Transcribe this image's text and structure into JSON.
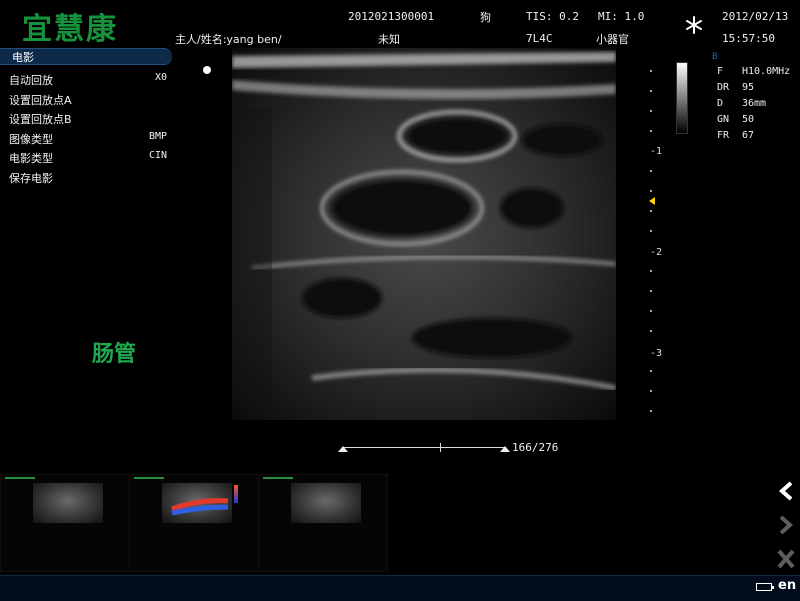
{
  "header": {
    "brand": "宜慧康",
    "patient_id": "2012021300001",
    "species": "狗",
    "tis": "TIS: 0.2",
    "mi": "MI: 1.0",
    "date": "2012/02/13",
    "owner_name": "主人/姓名:yang ben/",
    "gender": "未知",
    "probe": "7L4C",
    "exam_preset": "小器官",
    "time": "15:57:50",
    "freeze_icon": "snowflake-icon"
  },
  "menu": {
    "title": "电影",
    "items": [
      {
        "label": "自动回放",
        "value": "X0"
      },
      {
        "label": "设置回放点A",
        "value": ""
      },
      {
        "label": "设置回放点B",
        "value": ""
      },
      {
        "label": "图像类型",
        "value": "BMP"
      },
      {
        "label": "电影类型",
        "value": "CIN"
      },
      {
        "label": "保存电影",
        "value": ""
      }
    ]
  },
  "organ_label": "肠管",
  "depth_scale": {
    "labels": [
      "-1",
      "-2",
      "-3"
    ]
  },
  "params": {
    "mode": "B",
    "rows": [
      {
        "key": "F",
        "value": "H10.0MHz"
      },
      {
        "key": "DR",
        "value": "95"
      },
      {
        "key": "D",
        "value": "36mm"
      },
      {
        "key": "GN",
        "value": "50"
      },
      {
        "key": "FR",
        "value": "67"
      }
    ]
  },
  "cine": {
    "counter": "166/276",
    "frame": 166,
    "total": 276
  },
  "thumbnails": [
    "B-mode",
    "color-doppler",
    "B-mode"
  ],
  "nav": {
    "prev_icon": "chevron-left-icon",
    "next_icon": "chevron-right-icon",
    "close_icon": "close-icon"
  },
  "footer": {
    "language": "en",
    "battery_icon": "battery-icon"
  },
  "colors": {
    "brand_green": "#16923c",
    "label_green": "#1fa84f",
    "menu_blue": "#0e2a4a",
    "focus_yellow": "#ffd400"
  }
}
